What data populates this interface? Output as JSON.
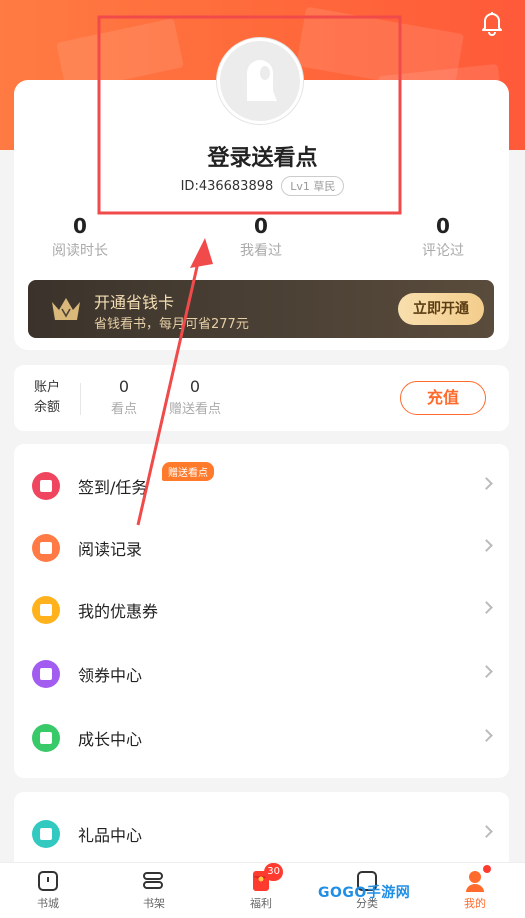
{
  "colors": {
    "accent": "#ff6b2c",
    "header_gradient_start": "#ff7b43",
    "header_gradient_end": "#ff5a3a",
    "vip_bg": "#3b332b",
    "annotation_red": "#f04a4a"
  },
  "header": {
    "bell_icon": "bell-icon"
  },
  "profile": {
    "avatar_icon": "default-avatar-icon",
    "name": "登录送看点",
    "id_text": "ID:436683898",
    "level": "Lv1 草民"
  },
  "stats": [
    {
      "value": "0",
      "label": "阅读时长"
    },
    {
      "value": "0",
      "label": "我看过"
    },
    {
      "value": "0",
      "label": "评论过"
    }
  ],
  "vip": {
    "title": "开通省钱卡",
    "subtitle": "省钱看书，每月可省277元",
    "button": "立即开通"
  },
  "balance": {
    "label_line1": "账户",
    "label_line2": "余额",
    "items": [
      {
        "value": "0",
        "label": "看点"
      },
      {
        "value": "0",
        "label": "赠送看点"
      }
    ],
    "recharge": "充值"
  },
  "menu": [
    {
      "label": "签到/任务",
      "badge": "赠送看点",
      "icon": "calendar-icon",
      "color": "#f0455e"
    },
    {
      "label": "阅读记录",
      "icon": "book-icon",
      "color": "#ff7a45"
    },
    {
      "label": "我的优惠券",
      "icon": "coupon-icon",
      "color": "#ffb21c"
    },
    {
      "label": "领券中心",
      "icon": "flag-icon",
      "color": "#a25cf0"
    },
    {
      "label": "成长中心",
      "icon": "star-icon",
      "color": "#38c968"
    }
  ],
  "menu2": [
    {
      "label": "礼品中心",
      "icon": "gift-icon",
      "color": "#31c9c0"
    }
  ],
  "bottom_nav": [
    {
      "label": "书城",
      "icon": "bookstore-icon"
    },
    {
      "label": "书架",
      "icon": "bookshelf-icon"
    },
    {
      "label": "福利",
      "icon": "red-envelope-icon",
      "badge": "30"
    },
    {
      "label": "分类",
      "icon": "category-icon"
    },
    {
      "label": "我的",
      "icon": "profile-icon",
      "active": true
    }
  ],
  "watermark": "GOGO手游网"
}
